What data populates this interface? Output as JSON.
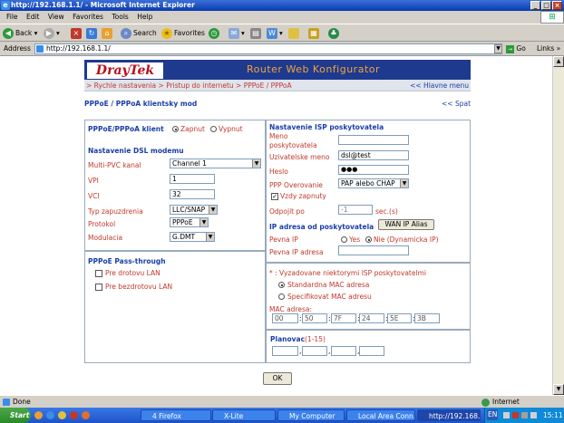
{
  "window": {
    "title": "http://192.168.1.1/ - Microsoft Internet Explorer"
  },
  "menu": [
    "File",
    "Edit",
    "View",
    "Favorites",
    "Tools",
    "Help"
  ],
  "toolbar": {
    "back": "Back",
    "search": "Search",
    "favorites": "Favorites"
  },
  "address": {
    "label": "Address",
    "url": "http://192.168.1.1/",
    "go": "Go",
    "links": "Links"
  },
  "app": {
    "logo": "DrayTek",
    "title": "Router Web Konfigurator"
  },
  "breadcrumb": {
    "path": "> Rychle nastavenia > Pristup do internetu > PPPoE / PPPoA",
    "main_link": "<< Hlavne menu"
  },
  "page": {
    "heading": "PPPoE / PPPoA klientsky mod",
    "back_link": "<< Spat"
  },
  "client": {
    "label": "PPPoE/PPPoA klient",
    "on": "Zapnut",
    "off": "Vypnut"
  },
  "dsl": {
    "title": "Nastavenie DSL modemu",
    "multi_pvc_label": "Multi-PVC kanal",
    "multi_pvc_value": "Channel 1",
    "vpi_label": "VPI",
    "vpi_value": "1",
    "vci_label": "VCI",
    "vci_value": "32",
    "encap_label": "Typ zapuzdrenia",
    "encap_value": "LLC/SNAP",
    "protocol_label": "Protokol",
    "protocol_value": "PPPoE",
    "modulation_label": "Modulacia",
    "modulation_value": "G.DMT"
  },
  "passthrough": {
    "title": "PPPoE Pass-through",
    "wired": "Pre drotovu LAN",
    "wireless": "Pre bezdrotovu LAN"
  },
  "isp": {
    "title": "Nastavenie ISP poskytovatela",
    "name_label": "Meno poskytovatela",
    "name_value": "",
    "user_label": "Uzivatelske meno",
    "user_value": "dsl@test",
    "password_label": "Heslo",
    "password_value": "●●●",
    "auth_label": "PPP Overovanie",
    "auth_value": "PAP alebo CHAP",
    "always_on": "Vzdy zapnuty",
    "idle_label": "Odpojit po",
    "idle_value": "-1",
    "idle_unit": "sec.(s)"
  },
  "ip": {
    "title": "IP adresa od poskytovatela",
    "wan_button": "WAN IP Alias",
    "fixed_label": "Pevna IP",
    "yes": "Yes",
    "no": "Nie (Dynamicka IP)",
    "fixed_addr_label": "Pevna IP adresa",
    "fixed_addr_value": ""
  },
  "mac": {
    "note": "* : Vyzadovane niektorymi ISP poskytovatelmi",
    "standard": "Standardna MAC adresa",
    "custom": "Specifikovat MAC adresu",
    "label": "MAC adresa:",
    "octets": [
      "00",
      "50",
      "7F",
      "24",
      "5E",
      "3B"
    ]
  },
  "schedule": {
    "label": "Planovac",
    "range": "(1-15)"
  },
  "ok": "OK",
  "status": {
    "text": "Done",
    "zone": "Internet"
  },
  "taskbar": {
    "start": "Start",
    "tasks": [
      "4 Firefox",
      "X-Lite",
      "My Computer",
      "Local Area Conn...",
      "http://192.168..."
    ],
    "lang": "EN",
    "clock": "15:11"
  }
}
